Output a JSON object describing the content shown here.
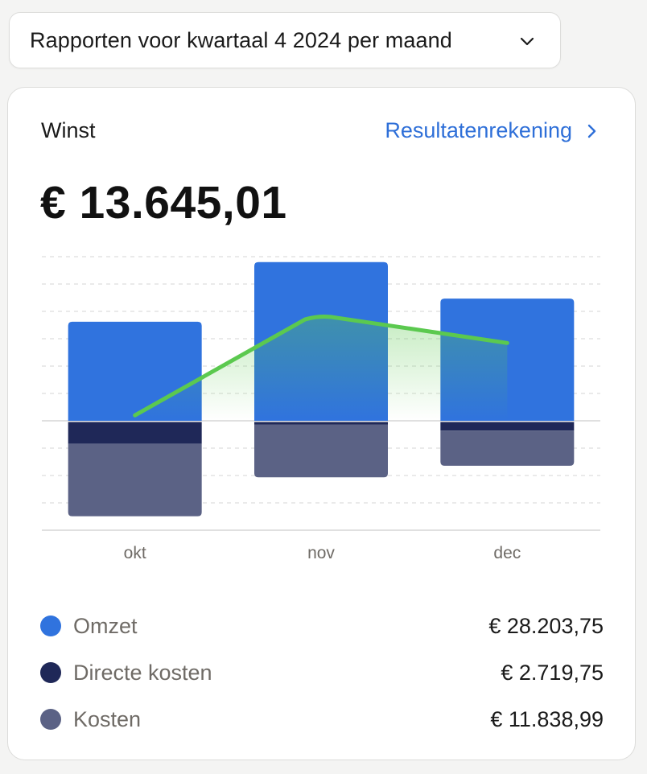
{
  "period_select": {
    "label": "Rapporten voor kwartaal 4 2024 per maand",
    "icon": "chevron-down-icon"
  },
  "card": {
    "title": "Winst",
    "link_label": "Resultatenrekening",
    "link_icon": "chevron-right-icon",
    "amount": "€ 13.645,01"
  },
  "colors": {
    "omzet": "#3073de",
    "directe_kosten": "#1f2858",
    "kosten": "#5b6285",
    "winst_line": "#5bc94f",
    "link": "#2e6fd8"
  },
  "chart_data": {
    "type": "bar",
    "categories": [
      "okt",
      "nov",
      "dec"
    ],
    "series": [
      {
        "name": "Omzet",
        "values": [
          8150,
          13050,
          10050
        ]
      },
      {
        "name": "Directe kosten",
        "values": [
          -1900,
          -300,
          -800
        ]
      },
      {
        "name": "Kosten",
        "values": [
          -5950,
          -4350,
          -2900
        ]
      },
      {
        "name": "Winst",
        "type": "line",
        "values": [
          450,
          8600,
          6400
        ]
      }
    ],
    "ylim": [
      -9000,
      13500
    ],
    "grid": true,
    "stacked": true
  },
  "legend": [
    {
      "label": "Omzet",
      "value": "€ 28.203,75",
      "color": "#3073de"
    },
    {
      "label": "Directe kosten",
      "value": "€ 2.719,75",
      "color": "#1f2858"
    },
    {
      "label": "Kosten",
      "value": "€ 11.838,99",
      "color": "#5b6285"
    }
  ]
}
